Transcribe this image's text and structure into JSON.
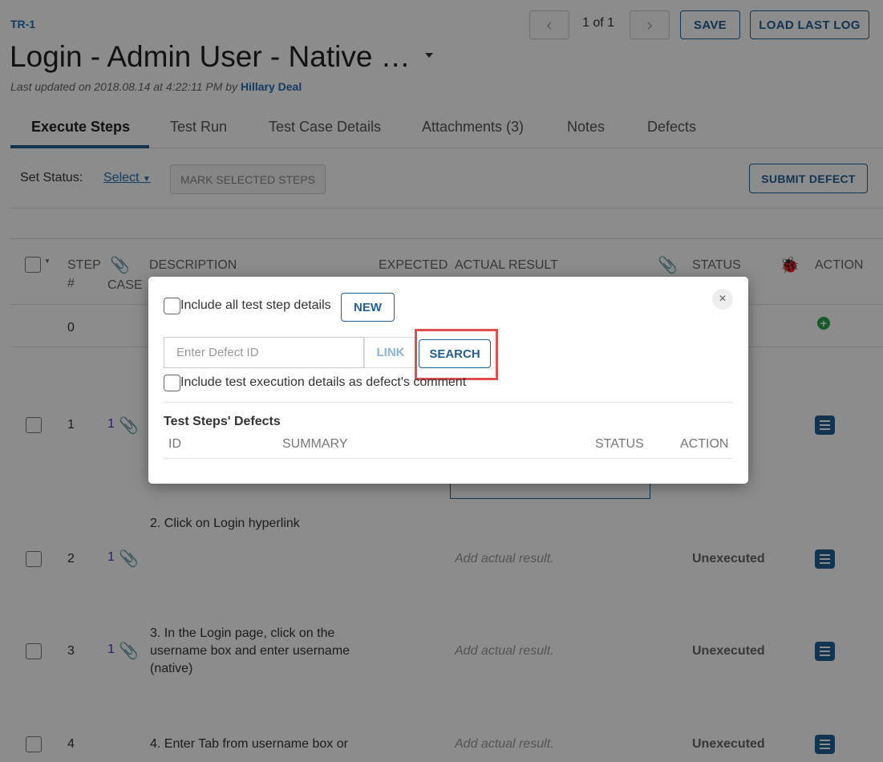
{
  "header": {
    "id": "TR-1",
    "title": "Login - Admin User - Native …",
    "updated_prefix": "Last updated on 2018.08.14 at 4:22:11 PM by",
    "updated_by": "Hillary Deal",
    "pager_text": "1 of 1",
    "save_label": "SAVE",
    "load_log_label": "LOAD LAST LOG"
  },
  "tabs": [
    {
      "label": "Execute Steps"
    },
    {
      "label": "Test Run"
    },
    {
      "label": "Test Case Details"
    },
    {
      "label": "Attachments (3)"
    },
    {
      "label": "Notes"
    },
    {
      "label": "Defects"
    }
  ],
  "toolbar": {
    "set_status_label": "Set Status:",
    "select_label": "Select",
    "mark_label": "MARK SELECTED STEPS",
    "submit_defect_label": "SUBMIT DEFECT"
  },
  "table": {
    "headers": {
      "step_line1": "STEP",
      "step_line2": "#",
      "case": "CASE",
      "description": "DESCRIPTION",
      "expected": "EXPECTED",
      "actual": "ACTUAL RESULT",
      "status": "STATUS",
      "action": "ACTION"
    },
    "rows": [
      {
        "step": "0"
      },
      {
        "step": "1",
        "case_count": "1"
      },
      {
        "step": "2",
        "case_count": "1",
        "description": "2. Click on Login hyperlink",
        "actual_placeholder": "Add actual result.",
        "status": "Unexecuted"
      },
      {
        "step": "3",
        "case_count": "1",
        "description_line1": "3. In the Login page, click on the",
        "description_line2": "username box and enter username",
        "description_line3": "(native)",
        "actual_placeholder": "Add actual result.",
        "status": "Unexecuted"
      },
      {
        "step": "4",
        "description_line1": "4. Enter Tab from username box or",
        "actual_placeholder": "Add actual result.",
        "status": "Unexecuted"
      }
    ]
  },
  "modal": {
    "include_steps_label": "Include all test step details",
    "new_label": "NEW",
    "close_symbol": "×",
    "defect_input_placeholder": "Enter Defect ID",
    "link_label": "LINK",
    "search_label": "SEARCH",
    "include_exec_label": "Include test execution details as defect's comment",
    "section_title": "Test Steps' Defects",
    "columns": {
      "id": "ID",
      "summary": "SUMMARY",
      "status": "STATUS",
      "action": "ACTION"
    }
  },
  "colors": {
    "accent": "#1f5f95",
    "highlight": "#e05050",
    "add_green": "#28a745"
  }
}
